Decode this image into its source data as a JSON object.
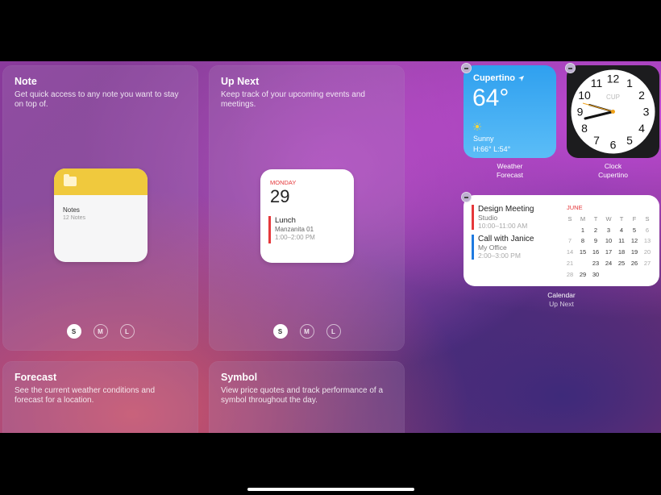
{
  "gallery": {
    "note": {
      "title": "Note",
      "desc": "Get quick access to any note you want to stay on top of.",
      "preview_name": "Notes",
      "preview_count": "12 Notes"
    },
    "upnext": {
      "title": "Up Next",
      "desc": "Keep track of your upcoming events and meetings.",
      "day": "MONDAY",
      "date": "29",
      "event_title": "Lunch",
      "event_location": "Manzanita 01",
      "event_time": "1:00–2:00 PM"
    },
    "forecast": {
      "title": "Forecast",
      "desc": "See the current weather conditions and forecast for a location."
    },
    "symbol": {
      "title": "Symbol",
      "desc": "View price quotes and track performance of a symbol throughout the day."
    },
    "sizes": [
      "S",
      "M",
      "L"
    ],
    "selected_size": "S"
  },
  "weather_widget": {
    "city": "Cupertino",
    "temp": "64°",
    "condition": "Sunny",
    "high_low": "H:66° L:54°",
    "label": "Weather",
    "sublabel": "Forecast"
  },
  "clock_widget": {
    "brand": "CUP",
    "label": "Clock",
    "sublabel": "Cupertino",
    "numbers": [
      "12",
      "1",
      "2",
      "3",
      "4",
      "5",
      "6",
      "7",
      "8",
      "9",
      "10",
      "11"
    ]
  },
  "calendar_widget": {
    "events": [
      {
        "title": "Design Meeting",
        "location": "Studio",
        "time": "10:00–11:00 AM"
      },
      {
        "title": "Call with Janice",
        "location": "My Office",
        "time": "2:00–3:00 PM"
      }
    ],
    "month": "JUNE",
    "weekdays": [
      "S",
      "M",
      "T",
      "W",
      "T",
      "F",
      "S"
    ],
    "weeks": [
      [
        "",
        "1",
        "2",
        "3",
        "4",
        "5",
        "6"
      ],
      [
        "7",
        "8",
        "9",
        "10",
        "11",
        "12",
        "13"
      ],
      [
        "14",
        "15",
        "16",
        "17",
        "18",
        "19",
        "20"
      ],
      [
        "21",
        "22",
        "23",
        "24",
        "25",
        "26",
        "27"
      ],
      [
        "28",
        "29",
        "30",
        "",
        "",
        "",
        ""
      ]
    ],
    "today": "22",
    "label": "Calendar",
    "sublabel": "Up Next"
  },
  "colors": {
    "accent_red": "#e5383b",
    "accent_blue": "#1f7ae0",
    "notes_yellow": "#f0c93d"
  }
}
